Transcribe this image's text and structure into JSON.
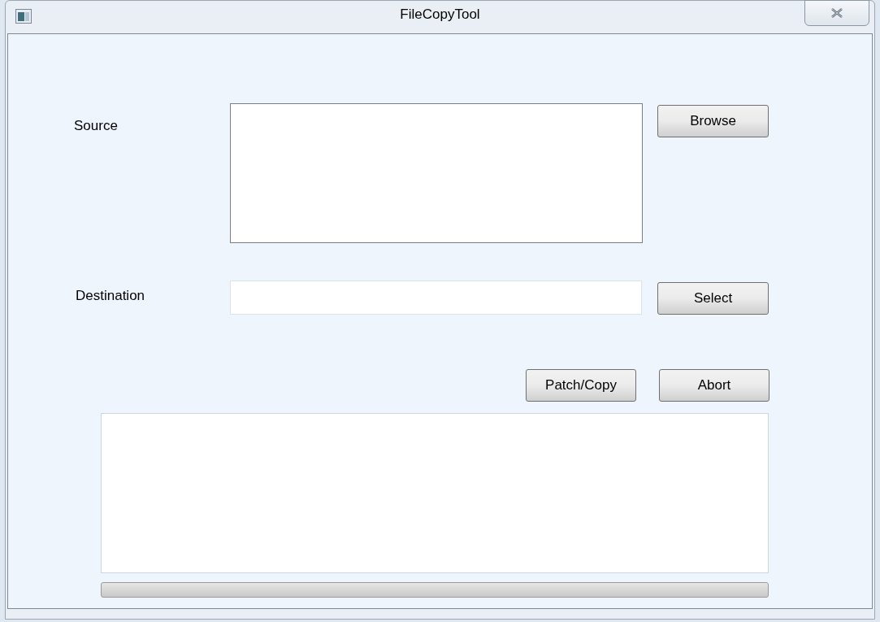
{
  "window": {
    "title": "FileCopyTool"
  },
  "source": {
    "label": "Source",
    "button": "Browse"
  },
  "destination": {
    "label": "Destination",
    "button": "Select"
  },
  "actions": [
    "Patch/Copy",
    "Abort"
  ],
  "progress": {
    "level": 0
  }
}
